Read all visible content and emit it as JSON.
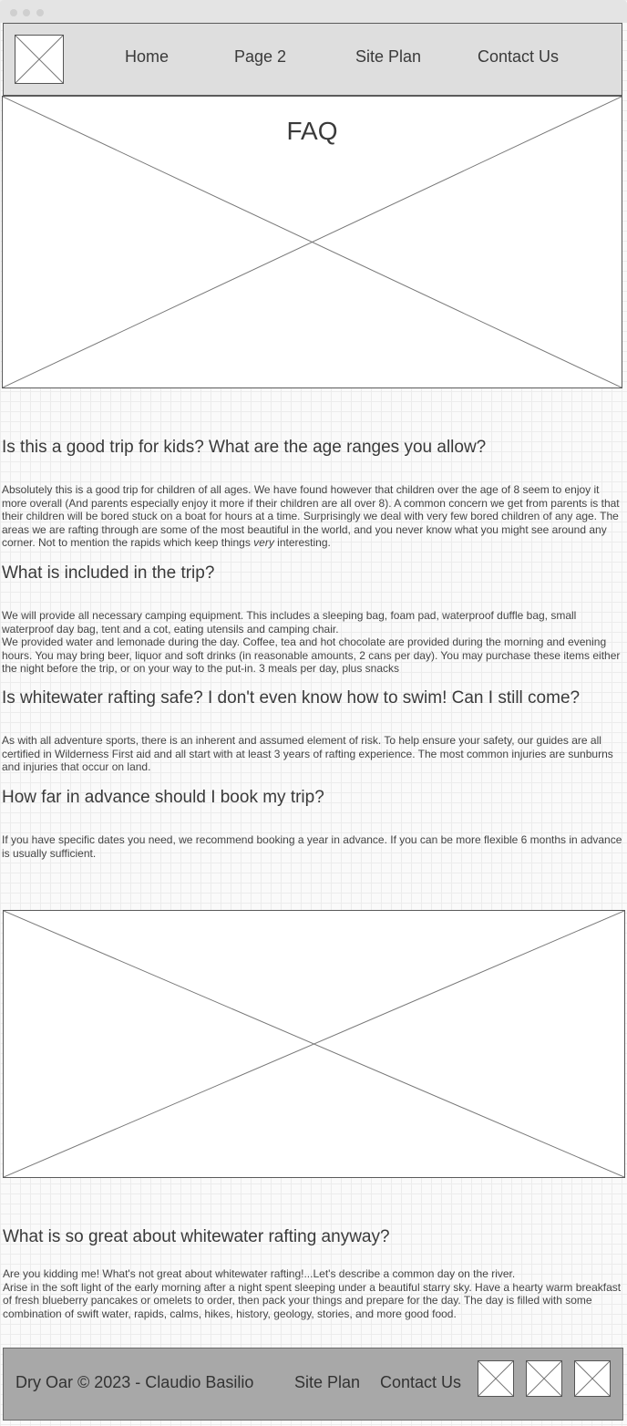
{
  "nav": {
    "logo_icon": "logo-placeholder",
    "items": [
      {
        "label": "Home"
      },
      {
        "label": "Page 2"
      },
      {
        "label": "Site Plan"
      },
      {
        "label": "Contact Us"
      }
    ]
  },
  "hero": {
    "title": "FAQ",
    "image_icon": "image-placeholder"
  },
  "faq": [
    {
      "question": "Is this a good trip for kids? What are the age ranges you allow?",
      "answer_before": "Absolutely this is a good trip for children of all ages. We have found however that children over the age of 8 seem to enjoy it more overall (And parents especially enjoy it more if their children are all over 8). A common concern we get from parents is that their children will be bored stuck on a boat for hours at a time. Surprisingly we deal with very few bored children of any age. The areas we are rafting through are some of the most beautiful in the world, and you never know what you might see around any corner. Not to mention the rapids which keep things ",
      "answer_emphasis": "very",
      "answer_after": " interesting."
    },
    {
      "question": "What is included in the trip?",
      "answer_1": "We will provide all necessary camping equipment. This includes a sleeping bag, foam pad, waterproof duffle bag, small waterproof day bag, tent and a cot, eating utensils and camping chair.",
      "answer_2": "We provided water and lemonade during the day. Coffee, tea and hot chocolate are provided during the morning and evening hours. You may bring beer, liquor and soft drinks (in reasonable amounts, 2 cans per day). You may purchase these items either the night before the trip, or on your way to the put-in. 3 meals per day, plus snacks"
    },
    {
      "question": "Is whitewater rafting safe? I don't even know how to swim! Can I still come?",
      "answer": "As with all adventure sports, there is an inherent and assumed element of risk. To help ensure your safety, our guides are all certified in Wilderness First aid and all start with at least 3 years of rafting experience. The most common injuries are sunburns and injuries that occur on land."
    },
    {
      "question": "How far in advance should I book my trip?",
      "answer": "If you have specific dates you need, we recommend booking a year in advance. If you can be more flexible 6 months in advance is usually sufficient."
    }
  ],
  "feature": {
    "image_icon": "image-placeholder",
    "question": "What is so great about whitewater rafting anyway?",
    "answer_1": "Are you kidding me! What's not great about whitewater rafting!...Let's describe a common day on the river.",
    "answer_2": "Arise in the soft light of the early morning after a night spent sleeping under a beautiful starry sky. Have a hearty warm breakfast of fresh blueberry pancakes or omelets to order, then pack your things and prepare for the day. The day is filled with some combination of swift water, rapids, calms, hikes, history, geology, stories, and more good food."
  },
  "footer": {
    "copyright": "Dry Oar © 2023 - Claudio Basilio",
    "links": [
      {
        "label": "Site Plan"
      },
      {
        "label": "Contact Us"
      }
    ],
    "social_icons": [
      "social-placeholder",
      "social-placeholder",
      "social-placeholder"
    ]
  },
  "colors": {
    "header_bg": "#dedede",
    "footer_bg": "#a8a8a8",
    "text": "#3a3a3a",
    "placeholder_stroke": "#777777"
  }
}
